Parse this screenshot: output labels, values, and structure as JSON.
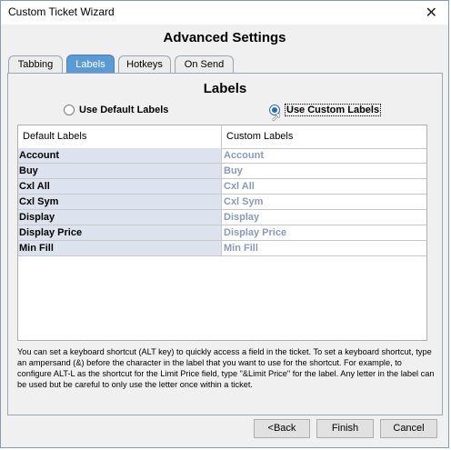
{
  "window": {
    "title": "Custom Ticket Wizard"
  },
  "heading": "Advanced Settings",
  "tabs": [
    {
      "label": "Tabbing"
    },
    {
      "label": "Labels",
      "active": true
    },
    {
      "label": "Hotkeys"
    },
    {
      "label": "On Send"
    }
  ],
  "panel": {
    "title": "Labels",
    "radio_default": "Use Default Labels",
    "radio_custom": "Use Custom Labels",
    "selected": "custom"
  },
  "grid": {
    "headers": [
      "Default Labels",
      "Custom Labels"
    ],
    "rows": [
      {
        "default": "Account",
        "custom": "Account"
      },
      {
        "default": "Buy",
        "custom": "Buy"
      },
      {
        "default": "Cxl All",
        "custom": "Cxl All"
      },
      {
        "default": "Cxl Sym",
        "custom": "Cxl Sym"
      },
      {
        "default": "Display",
        "custom": "Display"
      },
      {
        "default": "Display Price",
        "custom": "Display Price"
      },
      {
        "default": "Min Fill",
        "custom": "Min Fill"
      }
    ]
  },
  "help_text": "You can set a keyboard shortcut (ALT key) to quickly access a field in the ticket.  To set a keyboard shortcut, type an ampersand (&) before the character in the label that you want to use for the shortcut.  For example, to configure ALT-L as the shortcut for the Limit Price field, type \"&Limit Price\" for the label. Any letter in the label can be used but be careful to only use the letter once within a ticket.",
  "buttons": {
    "back": "<Back",
    "finish": "Finish",
    "cancel": "Cancel"
  },
  "colors": {
    "active_tab": "#5b9bd5",
    "radio_selected": "#2b6cb0",
    "custom_label_text": "#8a9ab8",
    "default_label_bg": "#dde3ee"
  },
  "icons": {
    "close": "close-icon",
    "cursor": "mouse-pointer-icon"
  }
}
